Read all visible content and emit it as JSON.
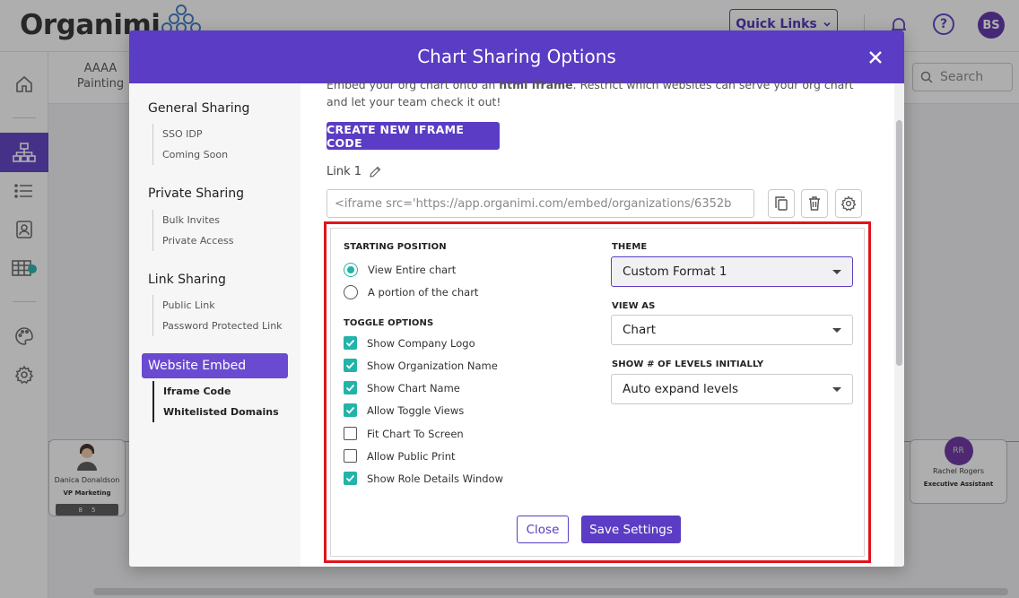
{
  "app": {
    "brand": "Organimi",
    "quick_links": "Quick Links",
    "avatar_initials": "BS",
    "help_glyph": "?",
    "subbar_item": "AAAA Painting",
    "search_placeholder": "Search",
    "accent_color": "#5b3cc4",
    "check_color": "#22b3a9",
    "highlight_color": "#e0141c"
  },
  "org_cards": [
    {
      "name": "Danica Donaldson",
      "role": "VP Marketing",
      "counts": [
        "8",
        "5"
      ]
    },
    {
      "initials": "RR",
      "name": "Rachel Rogers",
      "role": "Executive Assistant"
    }
  ],
  "modal": {
    "title": "Chart Sharing Options",
    "sidebar": {
      "groups": [
        {
          "label": "General Sharing",
          "items": [
            "SSO IDP",
            "Coming Soon"
          ]
        },
        {
          "label": "Private Sharing",
          "items": [
            "Bulk Invites",
            "Private Access"
          ]
        },
        {
          "label": "Link Sharing",
          "items": [
            "Public Link",
            "Password Protected Link"
          ]
        }
      ],
      "active": "Website Embed",
      "active_items": [
        "Iframe Code",
        "Whitelisted Domains"
      ]
    },
    "intro_a": "Embed your org chart onto an ",
    "intro_bold": "html iframe",
    "intro_b": ". Restrict which websites can serve your org chart and let your team check it out!",
    "create_button": "CREATE NEW IFRAME CODE",
    "link_name": "Link 1",
    "iframe_code": "<iframe src='https://app.organimi.com/embed/organizations/6352b",
    "starting_position": {
      "title": "STARTING POSITION",
      "options": [
        "View Entire chart",
        "A portion of the chart"
      ],
      "selected": 0
    },
    "toggle_options": {
      "title": "TOGGLE OPTIONS",
      "items": [
        {
          "label": "Show Company Logo",
          "checked": true
        },
        {
          "label": "Show Organization Name",
          "checked": true
        },
        {
          "label": "Show Chart Name",
          "checked": true
        },
        {
          "label": "Allow Toggle Views",
          "checked": true
        },
        {
          "label": "Fit Chart To Screen",
          "checked": false
        },
        {
          "label": "Allow Public Print",
          "checked": false
        },
        {
          "label": "Show Role Details Window",
          "checked": true
        }
      ]
    },
    "theme": {
      "title": "THEME",
      "value": "Custom Format 1"
    },
    "view_as": {
      "title": "VIEW AS",
      "value": "Chart"
    },
    "levels": {
      "title": "SHOW # OF LEVELS INITIALLY",
      "value": "Auto expand levels"
    },
    "close_button": "Close",
    "save_button": "Save Settings"
  }
}
